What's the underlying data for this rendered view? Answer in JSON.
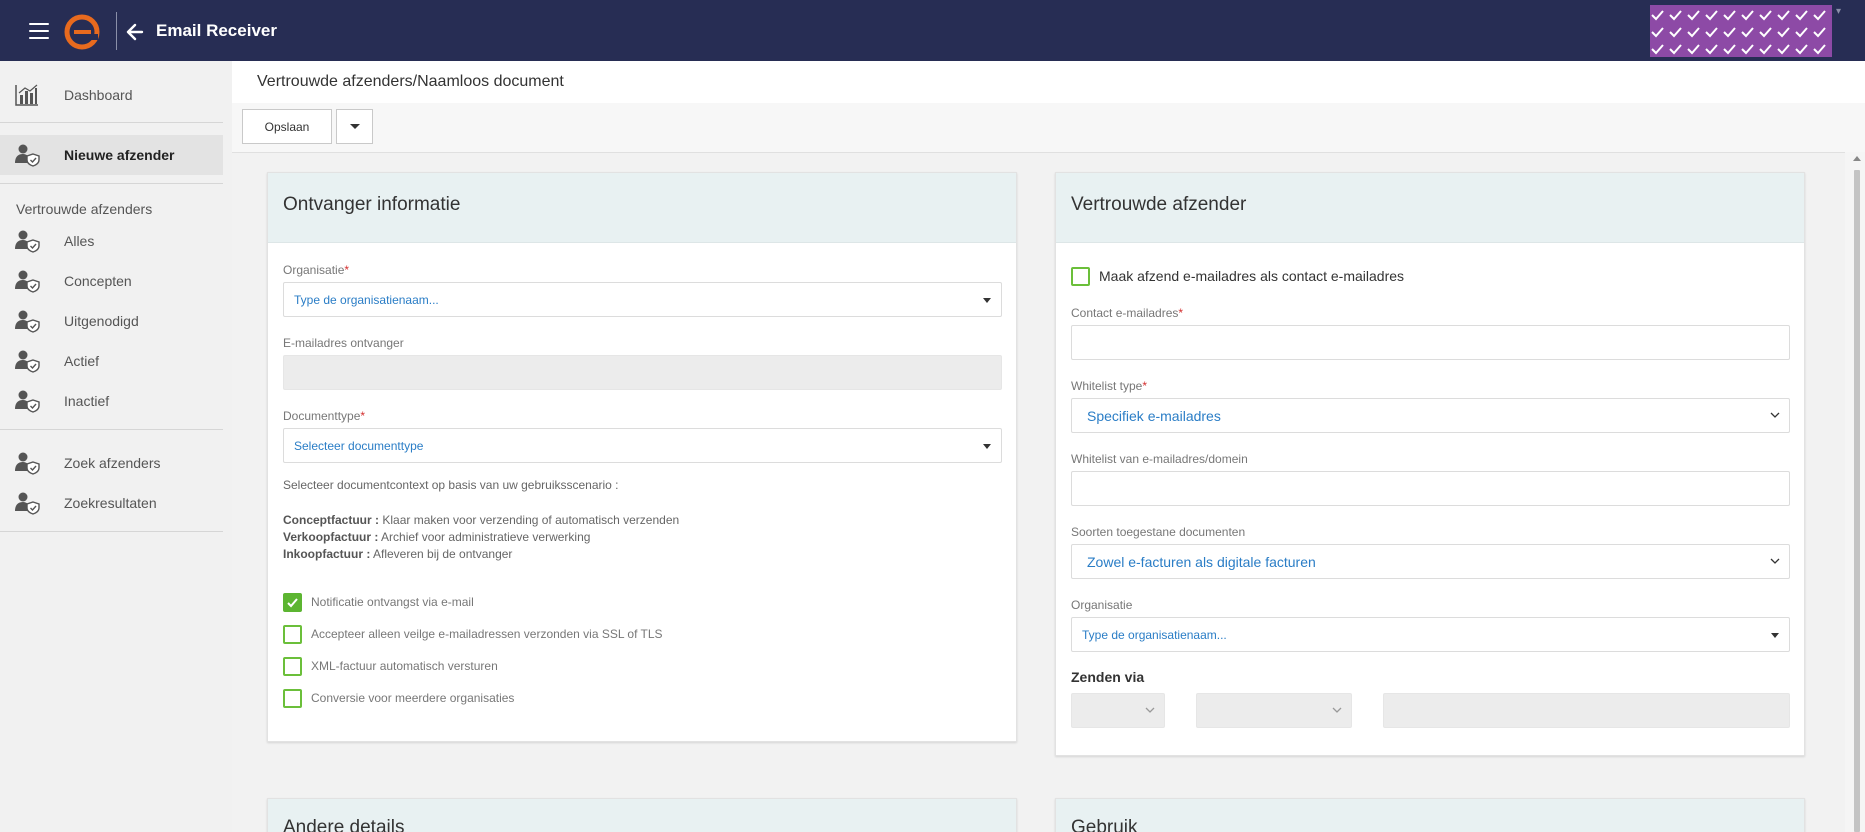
{
  "app": {
    "title": "Email Receiver",
    "brand_color": "#272d54",
    "accent_color": "#e86a1e"
  },
  "sidebar": {
    "dashboard": "Dashboard",
    "new_sender": "Nieuwe afzender",
    "section_title": "Vertrouwde afzenders",
    "items": [
      "Alles",
      "Concepten",
      "Uitgenodigd",
      "Actief",
      "Inactief"
    ],
    "search_senders": "Zoek afzenders",
    "search_results": "Zoekresultaten"
  },
  "breadcrumb": "Vertrouwde afzenders/Naamloos document",
  "toolbar": {
    "save_label": "Opslaan"
  },
  "receiver_panel": {
    "title": "Ontvanger informatie",
    "organisation_label": "Organisatie",
    "organisation_placeholder": "Type de organisatienaam...",
    "email_label": "E-mailadres ontvanger",
    "doctype_label": "Documenttype",
    "doctype_placeholder": "Selecteer documenttype",
    "context_intro": "Selecteer documentcontext op basis van uw gebruiksscenario :",
    "context_lines": [
      {
        "term": "Conceptfactuur :",
        "desc": "Klaar maken voor verzending of automatisch verzenden"
      },
      {
        "term": "Verkoopfactuur :",
        "desc": "Archief voor administratieve verwerking"
      },
      {
        "term": "Inkoopfactuur :",
        "desc": "Afleveren bij de ontvanger"
      }
    ],
    "checkboxes": [
      {
        "label": "Notificatie ontvangst via e-mail",
        "checked": true
      },
      {
        "label": "Accepteer alleen veilge e-mailadressen verzonden via SSL of TLS",
        "checked": false
      },
      {
        "label": "XML-factuur automatisch versturen",
        "checked": false
      },
      {
        "label": "Conversie voor meerdere organisaties",
        "checked": false
      }
    ]
  },
  "sender_panel": {
    "title": "Vertrouwde afzender",
    "make_contact_label": "Maak afzend e-mailadres als contact e-mailadres",
    "contact_label": "Contact e-mailadres",
    "whitelist_type_label": "Whitelist type",
    "whitelist_type_value": "Specifiek e-mailadres",
    "whitelist_list_label": "Whitelist van e-mailadres/domein",
    "allowed_docs_label": "Soorten toegestane documenten",
    "allowed_docs_value": "Zowel e-facturen als digitale facturen",
    "organisation_label": "Organisatie",
    "organisation_placeholder": "Type de organisatienaam...",
    "send_via_label": "Zenden via"
  },
  "lower_panels": {
    "other_details": "Andere details",
    "usage": "Gebruik"
  }
}
